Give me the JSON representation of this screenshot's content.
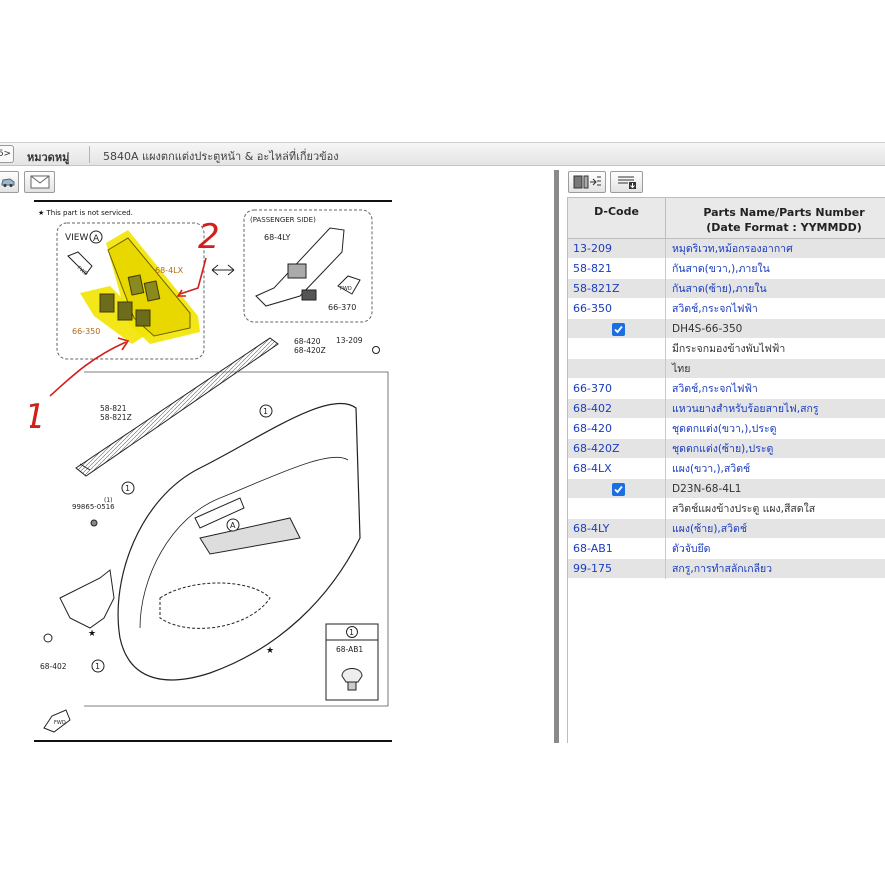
{
  "header": {
    "back_label": "6>",
    "category_label": "หมวดหมู่",
    "group_title": "5840A  แผงตกแต่งประตูหน้า & อะไหล่ที่เกี่ยวข้อง"
  },
  "toolbar_icons": [
    "car-icon",
    "envelope-icon"
  ],
  "panel_toolbar_icons": [
    "insert-parts-icon",
    "list-download-icon"
  ],
  "diagram": {
    "note": "★ This part is not serviced.",
    "view_label": "VIEW",
    "view_letter": "A",
    "passenger_side_label": "(PASSENGER SIDE)",
    "callouts": {
      "c_68_4ly": "68-4LY",
      "c_68_4lx": "68-4LX",
      "c_66_350": "66-350",
      "c_66_370": "66-370",
      "c_68_420": "68-420",
      "c_68_420z": "68-420Z",
      "c_13_209": "13-209",
      "c_58_821": "58-821",
      "c_58_821z": "58-821Z",
      "c_99865": "99865-0516",
      "c_99865_qty": "(1)",
      "c_68_402": "68-402",
      "c_68_ab1": "68-AB1",
      "circle_1": "1",
      "fwd": "FWD"
    },
    "handwritten": {
      "mark_1": "1",
      "mark_2": "2"
    },
    "highlight_color": "#f2e400",
    "annotation_color": "#d0201c"
  },
  "table": {
    "header": {
      "dcode": "D-Code",
      "name_line1": "Parts Name/Parts Number",
      "name_line2": "(Date Format : YYMMDD)"
    },
    "rows": [
      {
        "code": "13-209",
        "name": "หมุดริเวท,หม้อกรองอากาศ",
        "checked": false,
        "link": true
      },
      {
        "code": "58-821",
        "name": "กันสาด(ขวา,),ภายใน",
        "checked": false,
        "link": true
      },
      {
        "code": "58-821Z",
        "name": "กันสาด(ซ้าย),ภายใน",
        "checked": false,
        "link": true
      },
      {
        "code": "66-350",
        "name": "สวิตช์,กระจกไฟฟ้า",
        "checked": false,
        "link": true
      },
      {
        "code": "",
        "name": "DH4S-66-350",
        "checked": true,
        "link": false
      },
      {
        "code": "",
        "name": "มีกระจกมองข้างพับไฟฟ้า",
        "checked": false,
        "link": false
      },
      {
        "code": "",
        "name": "ไทย",
        "checked": false,
        "link": false
      },
      {
        "code": "66-370",
        "name": "สวิตช์,กระจกไฟฟ้า",
        "checked": false,
        "link": true
      },
      {
        "code": "68-402",
        "name": "แหวนยางสำหรับร้อยสายไฟ,สกรู",
        "checked": false,
        "link": true
      },
      {
        "code": "68-420",
        "name": "ชุดตกแต่ง(ขวา,),ประตู",
        "checked": false,
        "link": true
      },
      {
        "code": "68-420Z",
        "name": "ชุดตกแต่ง(ซ้าย),ประตู",
        "checked": false,
        "link": true
      },
      {
        "code": "68-4LX",
        "name": "แผง(ขวา,),สวิตช์",
        "checked": false,
        "link": true
      },
      {
        "code": "",
        "name": "D23N-68-4L1",
        "checked": true,
        "link": false
      },
      {
        "code": "",
        "name": "สวิตช์แผงข้างประตู แผง,สีสดใส",
        "checked": false,
        "link": false
      },
      {
        "code": "68-4LY",
        "name": "แผง(ซ้าย),สวิตช์",
        "checked": false,
        "link": true
      },
      {
        "code": "68-AB1",
        "name": "ตัวจับยึด",
        "checked": false,
        "link": true
      },
      {
        "code": "99-175",
        "name": "สกรู,การทำสลักเกลียว",
        "checked": false,
        "link": true
      }
    ]
  }
}
